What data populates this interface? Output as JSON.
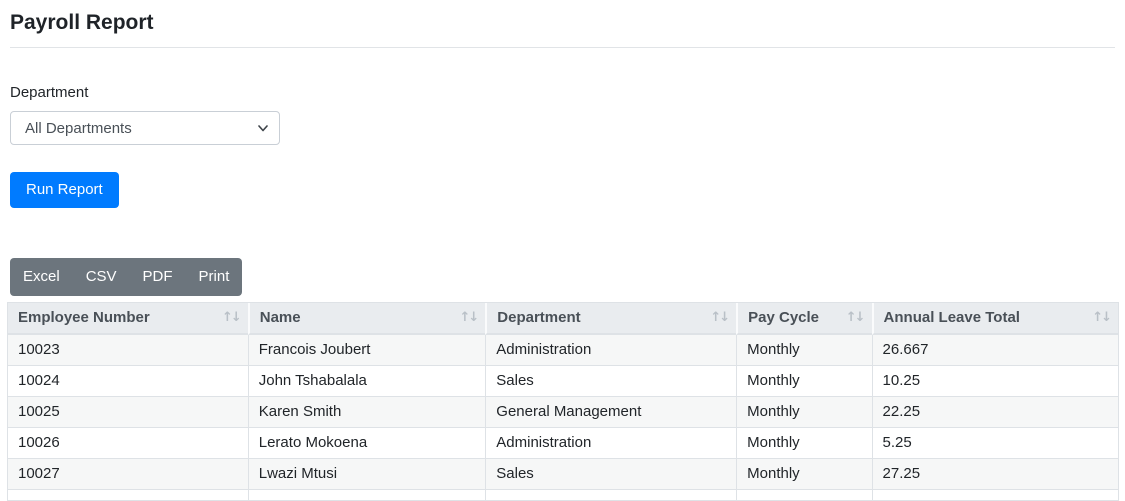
{
  "page": {
    "title": "Payroll Report"
  },
  "filters": {
    "department_label": "Department",
    "department_value": "All Departments",
    "run_button": "Run Report"
  },
  "export_buttons": [
    {
      "label": "Excel"
    },
    {
      "label": "CSV"
    },
    {
      "label": "PDF"
    },
    {
      "label": "Print"
    }
  ],
  "table": {
    "columns": [
      "Employee Number",
      "Name",
      "Department",
      "Pay Cycle",
      "Annual Leave Total"
    ],
    "rows": [
      [
        "10023",
        "Francois Joubert",
        "Administration",
        "Monthly",
        "26.667"
      ],
      [
        "10024",
        "John Tshabalala",
        "Sales",
        "Monthly",
        "10.25"
      ],
      [
        "10025",
        "Karen Smith",
        "General Management",
        "Monthly",
        "22.25"
      ],
      [
        "10026",
        "Lerato Mokoena",
        "Administration",
        "Monthly",
        "5.25"
      ],
      [
        "10027",
        "Lwazi Mtusi",
        "Sales",
        "Monthly",
        "27.25"
      ],
      [
        "",
        "",
        "",
        "",
        ""
      ]
    ]
  },
  "icons": {
    "sort": "sort-arrows",
    "dropdown": "chevron-down",
    "sort_glyph": "↑↓"
  },
  "colors": {
    "primary": "#007bff",
    "secondary": "#6c757d",
    "table_header_bg": "#e9ecef",
    "table_border": "#dee2e6",
    "stripe": "#f6f7f7",
    "text": "#212529",
    "muted_text": "#495057"
  }
}
